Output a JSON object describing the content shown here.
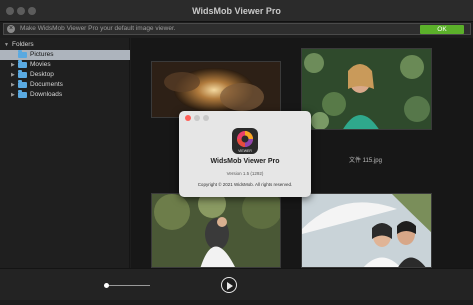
{
  "window": {
    "title": "WidsMob Viewer Pro"
  },
  "notice": {
    "text": "Make WidsMob Viewer Pro your default image viewer.",
    "ok_label": "OK"
  },
  "sidebar": {
    "header": "Folders",
    "items": [
      {
        "label": "Pictures",
        "selected": true
      },
      {
        "label": "Movies"
      },
      {
        "label": "Desktop"
      },
      {
        "label": "Documents"
      },
      {
        "label": "Downloads"
      }
    ]
  },
  "gallery": {
    "captions": [
      "文件 115.jpg"
    ]
  },
  "about": {
    "app_name": "WidsMob Viewer Pro",
    "version": "Version 1.5 (1292)",
    "copyright": "Copyright © 2021 WidsMob. All rights reserved.",
    "icon_text": "VIEWER"
  },
  "colors": {
    "ok_button": "#5bb02a",
    "selection": "#adb4bd",
    "folder_icon": "#5aa9e0"
  }
}
